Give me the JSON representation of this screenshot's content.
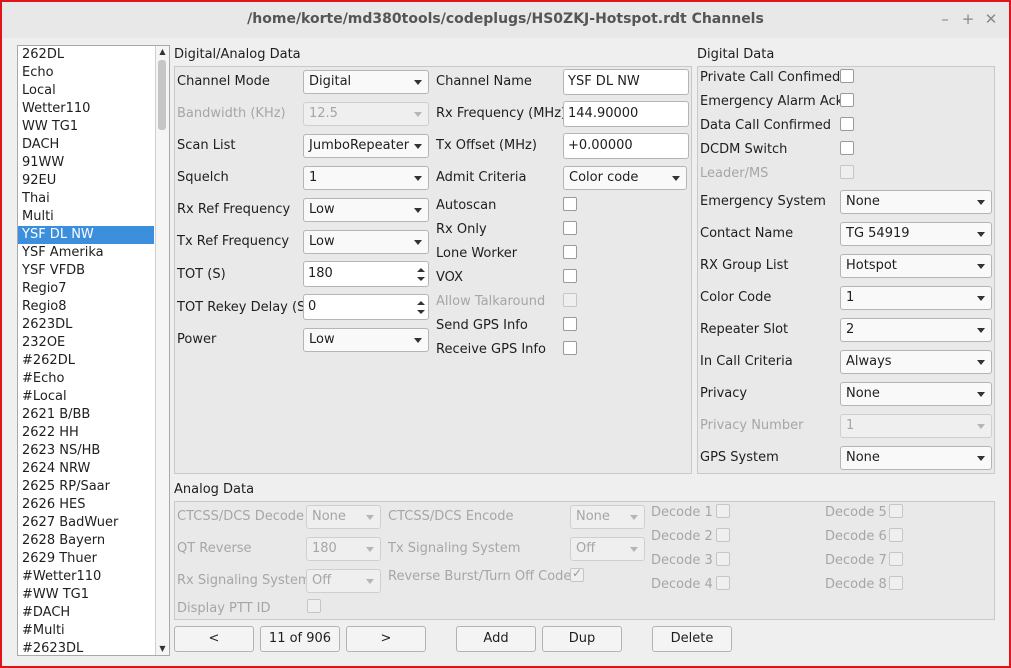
{
  "window": {
    "title": "/home/korte/md380tools/codeplugs/HS0ZKJ-Hotspot.rdt Channels",
    "controls": [
      "–",
      "+",
      "✕"
    ]
  },
  "channels": [
    "262DL",
    "Echo",
    "Local",
    "Wetter110",
    "WW TG1",
    "DACH",
    "91WW",
    "92EU",
    "Thai",
    "Multi",
    "YSF DL NW",
    "YSF Amerika",
    "YSF VFDB",
    "Regio7",
    "Regio8",
    "2623DL",
    "232OE",
    "#262DL",
    "#Echo",
    "#Local",
    "2621 B/BB",
    "2622 HH",
    "2623 NS/HB",
    "2624 NRW",
    "2625 RP/Saar",
    "2626 HES",
    "2627 BadWuer",
    "2628 Bayern",
    "2629 Thuer",
    "#Wetter110",
    "#WW TG1",
    "#DACH",
    "#Multi",
    "#2623DL"
  ],
  "selected_channel": "YSF DL NW",
  "digital_analog": {
    "title": "Digital/Analog Data",
    "channel_mode": {
      "label": "Channel Mode",
      "value": "Digital"
    },
    "bandwidth": {
      "label": "Bandwidth (KHz)",
      "value": "12.5"
    },
    "scan_list": {
      "label": "Scan List",
      "value": "JumboRepeater"
    },
    "squelch": {
      "label": "Squelch",
      "value": "1"
    },
    "rx_ref": {
      "label": "Rx Ref Frequency",
      "value": "Low"
    },
    "tx_ref": {
      "label": "Tx Ref Frequency",
      "value": "Low"
    },
    "tot": {
      "label": "TOT (S)",
      "value": "180"
    },
    "tot_rekey": {
      "label": "TOT Rekey Delay (S)",
      "value": "0"
    },
    "power": {
      "label": "Power",
      "value": "Low"
    },
    "channel_name": {
      "label": "Channel Name",
      "value": "YSF DL NW"
    },
    "rx_freq": {
      "label": "Rx Frequency (MHz)",
      "value": "144.90000"
    },
    "tx_offset": {
      "label": "Tx Offset (MHz)",
      "value": "+0.00000"
    },
    "admit": {
      "label": "Admit Criteria",
      "value": "Color code"
    },
    "autoscan": {
      "label": "Autoscan",
      "checked": false
    },
    "rx_only": {
      "label": "Rx Only",
      "checked": false
    },
    "lone_worker": {
      "label": "Lone Worker",
      "checked": false
    },
    "vox": {
      "label": "VOX",
      "checked": false
    },
    "allow_talkaround": {
      "label": "Allow Talkaround",
      "checked": false
    },
    "send_gps": {
      "label": "Send GPS Info",
      "checked": false
    },
    "receive_gps": {
      "label": "Receive GPS Info",
      "checked": false
    }
  },
  "digital": {
    "title": "Digital Data",
    "private_call": {
      "label": "Private Call Confimed",
      "checked": false
    },
    "emergency_alarm": {
      "label": "Emergency Alarm Ack",
      "checked": false
    },
    "data_call": {
      "label": "Data Call Confirmed",
      "checked": false
    },
    "dcdm": {
      "label": "DCDM Switch",
      "checked": false
    },
    "leader_ms": {
      "label": "Leader/MS",
      "checked": false
    },
    "emergency_system": {
      "label": "Emergency System",
      "value": "None"
    },
    "contact_name": {
      "label": "Contact Name",
      "value": "TG 54919"
    },
    "rx_group": {
      "label": "RX Group List",
      "value": "Hotspot"
    },
    "color_code": {
      "label": "Color Code",
      "value": "1"
    },
    "repeater_slot": {
      "label": "Repeater Slot",
      "value": "2"
    },
    "in_call": {
      "label": "In Call Criteria",
      "value": "Always"
    },
    "privacy": {
      "label": "Privacy",
      "value": "None"
    },
    "privacy_number": {
      "label": "Privacy Number",
      "value": "1"
    },
    "gps_system": {
      "label": "GPS System",
      "value": "None"
    }
  },
  "analog": {
    "title": "Analog Data",
    "ctcss_decode": {
      "label": "CTCSS/DCS Decode",
      "value": "None"
    },
    "ctcss_encode": {
      "label": "CTCSS/DCS Encode",
      "value": "None"
    },
    "qt_reverse": {
      "label": "QT Reverse",
      "value": "180"
    },
    "tx_signaling": {
      "label": "Tx Signaling System",
      "value": "Off"
    },
    "rx_signaling": {
      "label": "Rx Signaling System",
      "value": "Off"
    },
    "reverse_burst": {
      "label": "Reverse Burst/Turn Off Code",
      "checked": true
    },
    "display_ptt": {
      "label": "Display PTT ID",
      "checked": false
    },
    "decodes": [
      "Decode 1",
      "Decode 2",
      "Decode 3",
      "Decode 4",
      "Decode 5",
      "Decode 6",
      "Decode 7",
      "Decode 8"
    ]
  },
  "nav": {
    "prev": "<",
    "position": "11 of 906",
    "next": ">",
    "add": "Add",
    "dup": "Dup",
    "delete": "Delete"
  }
}
